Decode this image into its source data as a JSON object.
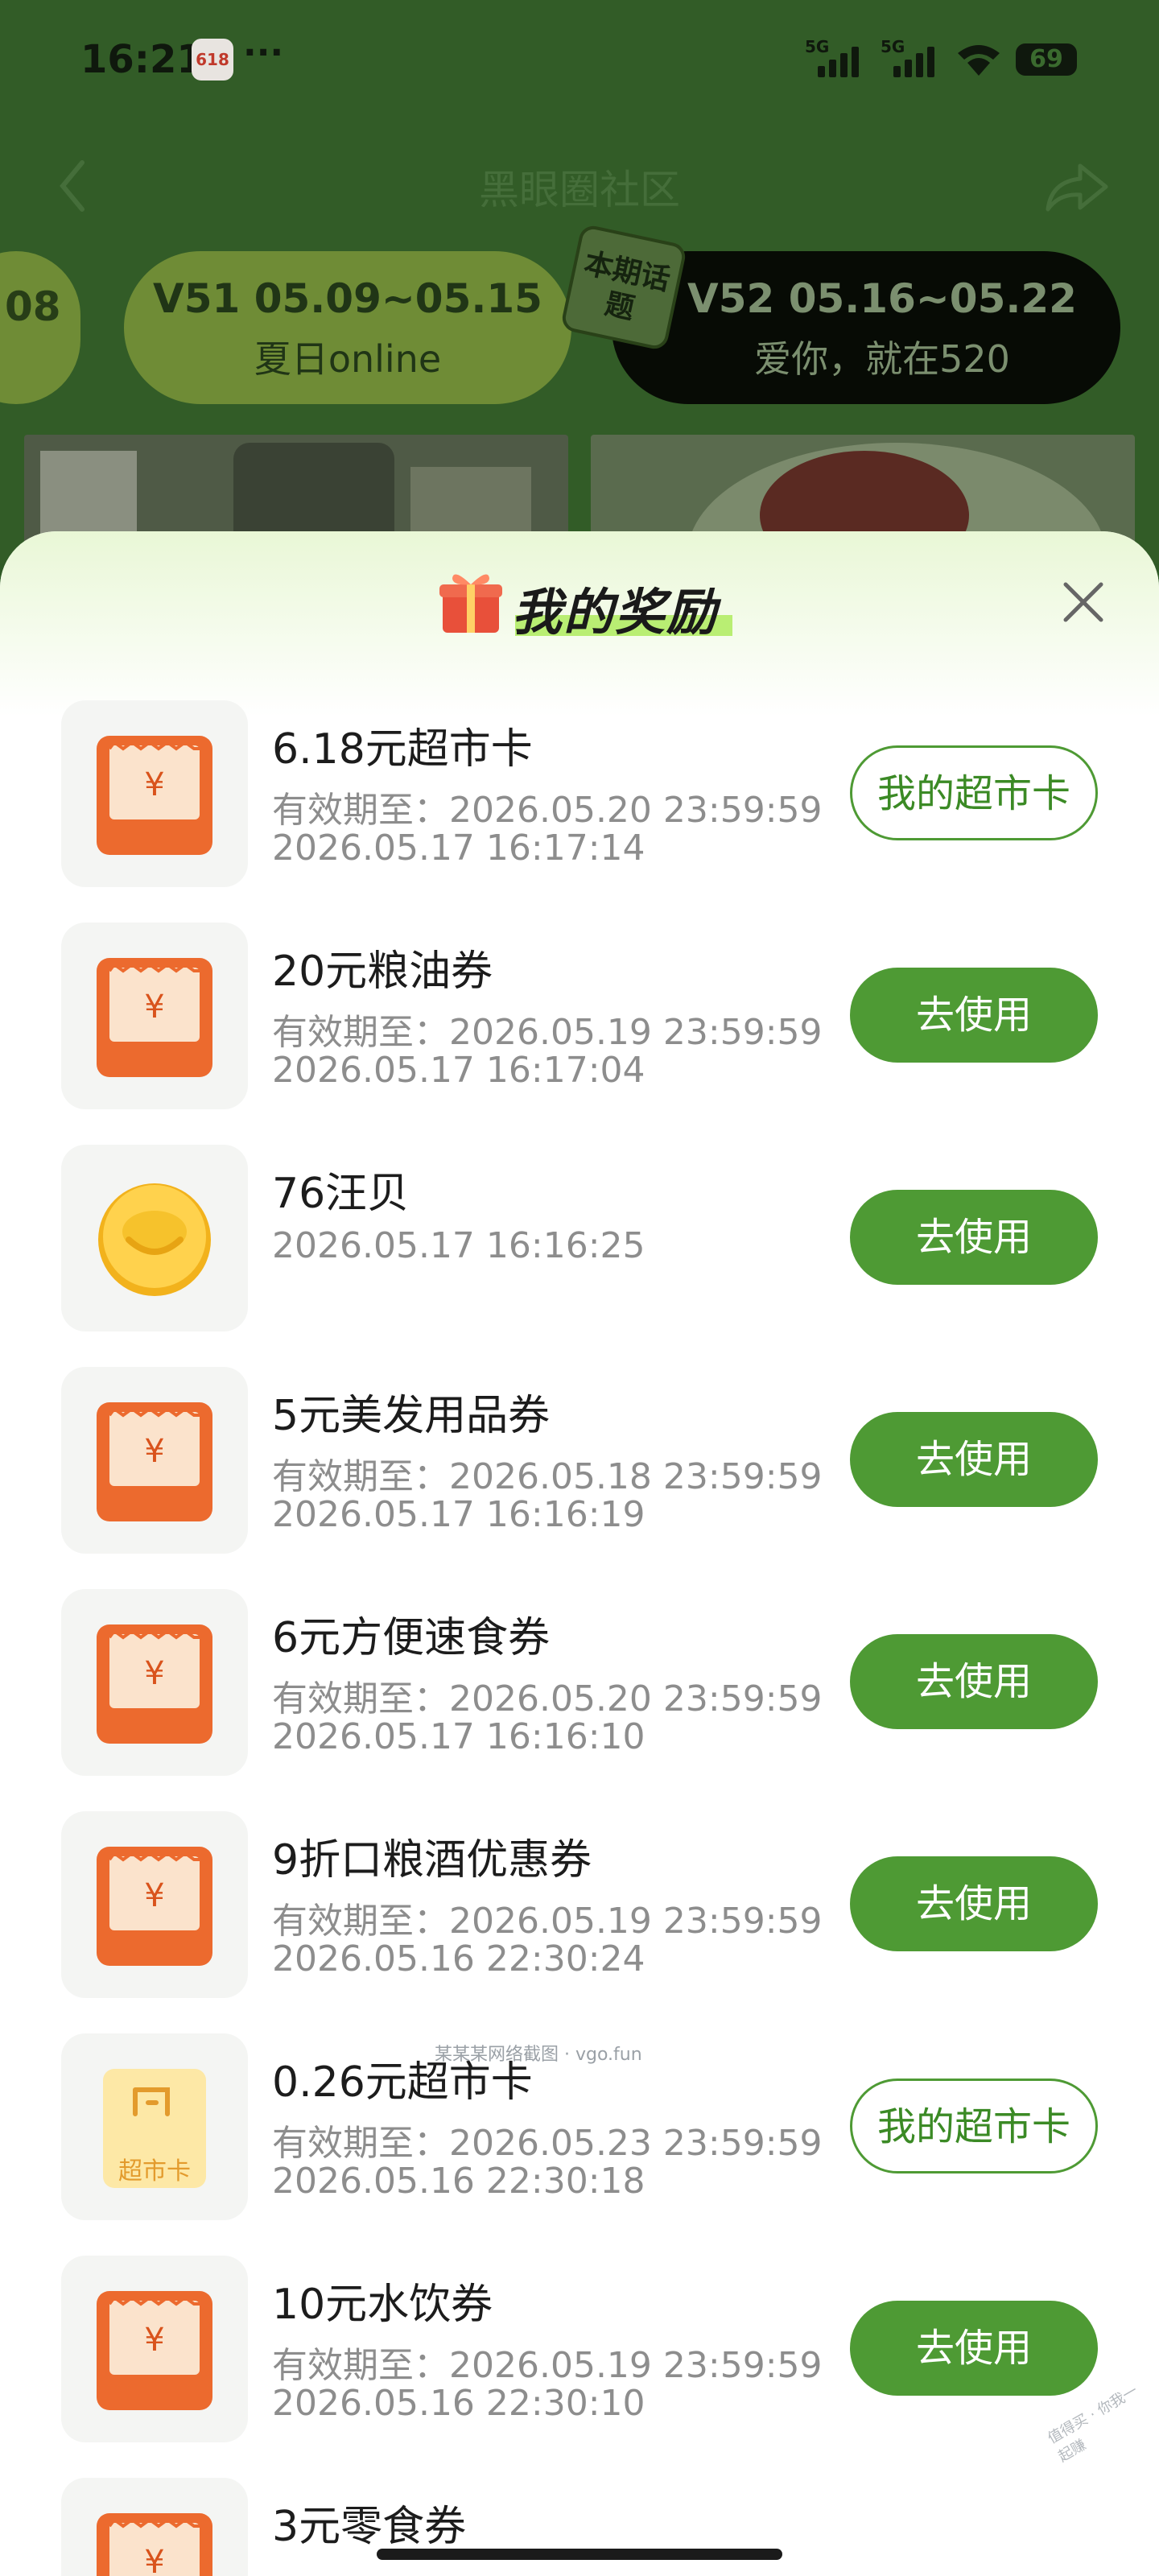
{
  "status_bar": {
    "time": "16:21",
    "badge": "618",
    "dots": "···",
    "signal_labels": [
      "5G",
      "5G"
    ],
    "battery": "69"
  },
  "nav": {
    "title": "黑眼圈社区"
  },
  "periods": {
    "left_partial": "08",
    "middle": {
      "line1": "V51 05.09~05.15",
      "line2": "夏日online"
    },
    "right": {
      "line1": "V52 05.16~05.22",
      "line2": "爱你，就在520"
    },
    "current_tag": "本期话题"
  },
  "sheet": {
    "title": "我的奖励",
    "close_label": "close"
  },
  "rewards": [
    {
      "icon": "coupon-icon",
      "name": "6.18元超市卡",
      "expiry": "有效期至：2026.05.20 23:59:59",
      "time": "2026.05.17 16:17:14",
      "button": "我的超市卡",
      "button_style": "outline"
    },
    {
      "icon": "coupon-icon",
      "name": "20元粮油券",
      "expiry": "有效期至：2026.05.19 23:59:59",
      "time": "2026.05.17 16:17:04",
      "button": "去使用",
      "button_style": "filled"
    },
    {
      "icon": "gold-coin-icon",
      "name": "76汪贝",
      "expiry": "",
      "time": "2026.05.17 16:16:25",
      "button": "去使用",
      "button_style": "filled"
    },
    {
      "icon": "coupon-icon",
      "name": "5元美发用品券",
      "expiry": "有效期至：2026.05.18 23:59:59",
      "time": "2026.05.17 16:16:19",
      "button": "去使用",
      "button_style": "filled"
    },
    {
      "icon": "coupon-icon",
      "name": "6元方便速食券",
      "expiry": "有效期至：2026.05.20 23:59:59",
      "time": "2026.05.17 16:16:10",
      "button": "去使用",
      "button_style": "filled"
    },
    {
      "icon": "coupon-icon",
      "name": "9折口粮酒优惠券",
      "expiry": "有效期至：2026.05.19 23:59:59",
      "time": "2026.05.16 22:30:24",
      "button": "去使用",
      "button_style": "filled"
    },
    {
      "icon": "supermarket-card-icon",
      "icon_text": "超市卡",
      "name": "0.26元超市卡",
      "expiry": "有效期至：2026.05.23 23:59:59",
      "time": "2026.05.16 22:30:18",
      "button": "我的超市卡",
      "button_style": "outline"
    },
    {
      "icon": "coupon-icon",
      "name": "10元水饮券",
      "expiry": "有效期至：2026.05.19 23:59:59",
      "time": "2026.05.16 22:30:10",
      "button": "去使用",
      "button_style": "filled"
    },
    {
      "icon": "coupon-icon",
      "name": "3元零食券",
      "expiry": "",
      "time": "",
      "button": "",
      "button_style": "none"
    }
  ],
  "coupon_symbol": "¥",
  "colors": {
    "accent_green": "#4e9a34",
    "coupon_orange": "#ec6a2e",
    "dim_green": "#325c27"
  }
}
